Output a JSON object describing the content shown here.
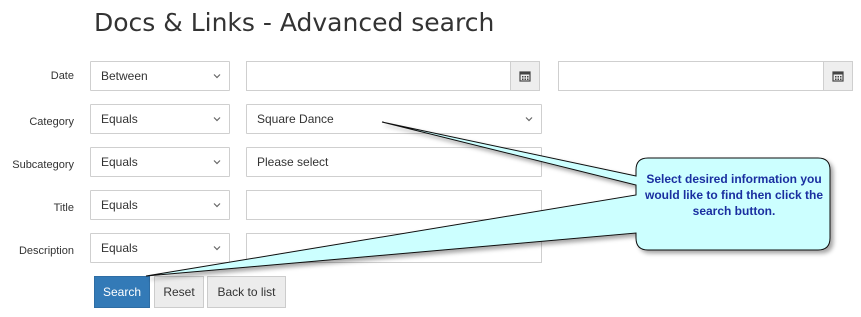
{
  "page": {
    "title": "Docs & Links - Advanced search"
  },
  "form": {
    "date": {
      "label": "Date",
      "operator": "Between",
      "from_value": "",
      "to_value": ""
    },
    "category": {
      "label": "Category",
      "operator": "Equals",
      "value": "Square Dance"
    },
    "subcategory": {
      "label": "Subcategory",
      "operator": "Equals",
      "value": "Please select"
    },
    "title": {
      "label": "Title",
      "operator": "Equals",
      "value": ""
    },
    "description": {
      "label": "Description",
      "operator": "Equals",
      "value": ""
    }
  },
  "buttons": {
    "search": "Search",
    "reset": "Reset",
    "back": "Back to list"
  },
  "callout": {
    "text": "Select desired information you would like to find then click the search button."
  },
  "colors": {
    "primary": "#337ab7",
    "callout_fill": "#ccffff",
    "callout_text": "#1a2fa0"
  },
  "icons": {
    "calendar": "calendar-icon",
    "dropdown": "chevron-down-icon"
  }
}
